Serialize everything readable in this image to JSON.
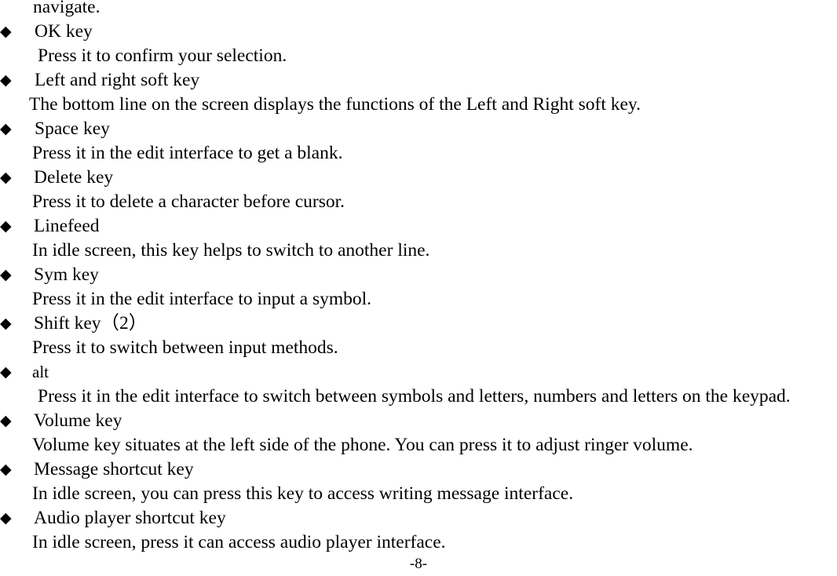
{
  "page": {
    "continuation_line": "navigate.",
    "footer": "-8-",
    "bullet_glyph": "◆",
    "text_color": "#000000",
    "background_color": "#ffffff"
  },
  "entries": [
    {
      "heading": "OK key",
      "body": "Press it to confirm your selection."
    },
    {
      "heading": "Left and right soft key",
      "body": "The bottom line on the screen displays the functions of the Left and Right soft key."
    },
    {
      "heading": "Space key",
      "body": "Press it in the edit interface to get a blank."
    },
    {
      "heading": "Delete key",
      "body": "Press it to delete a character before cursor."
    },
    {
      "heading": "Linefeed",
      "body": "In idle screen, this key helps to switch to another line."
    },
    {
      "heading": "Sym key",
      "body": "Press it in the edit interface to input a symbol."
    },
    {
      "heading": "Shift key（2）",
      "body": "Press it to switch between input methods."
    },
    {
      "heading": "alt",
      "body": "Press it in the edit interface to switch between symbols and letters, numbers and letters on the keypad."
    },
    {
      "heading": "Volume key",
      "body": "Volume key situates at the left side of the phone. You can press it to adjust ringer volume."
    },
    {
      "heading": "Message shortcut key",
      "body": "In idle screen, you can press this key to access writing message interface."
    },
    {
      "heading": "Audio player shortcut key",
      "body": "In idle screen, press it can access audio player interface."
    }
  ]
}
